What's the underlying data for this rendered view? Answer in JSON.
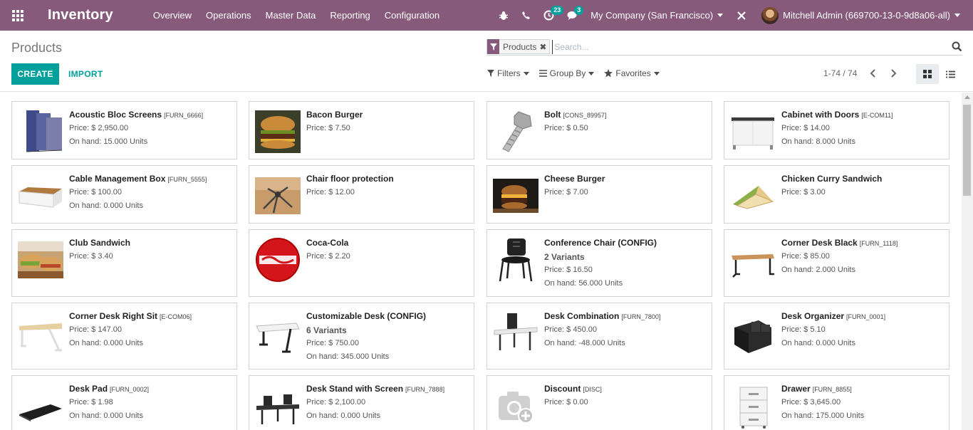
{
  "navbar": {
    "apps_icon": "apps-grid-icon",
    "brand": "Inventory",
    "menu": [
      "Overview",
      "Operations",
      "Master Data",
      "Reporting",
      "Configuration"
    ],
    "activity_badge": "23",
    "messages_badge": "3",
    "company": "My Company (San Francisco)",
    "user": "Mitchell Admin (669700-13-0-9d8a06-all)",
    "brand_color": "#875a7b"
  },
  "control": {
    "title": "Products",
    "create_label": "CREATE",
    "import_label": "IMPORT",
    "facet_label": "Products",
    "search_placeholder": "Search...",
    "filters_label": "Filters",
    "groupby_label": "Group By",
    "favorites_label": "Favorites",
    "pager": "1-74 / 74",
    "accent_color": "#00a09d"
  },
  "products": [
    {
      "name": "Acoustic Bloc Screens",
      "ref": "[FURN_6666]",
      "price": "Price: $ 2,950.00",
      "onhand": "On hand: 15.000 Units",
      "icon": "acoustic-screens-image"
    },
    {
      "name": "Bacon Burger",
      "ref": "",
      "price": "Price: $ 7.50",
      "onhand": "",
      "icon": "burger-image"
    },
    {
      "name": "Bolt",
      "ref": "[CONS_89957]",
      "price": "Price: $ 0.50",
      "onhand": "",
      "icon": "bolt-image"
    },
    {
      "name": "Cabinet with Doors",
      "ref": "[E-COM11]",
      "price": "Price: $ 14.00",
      "onhand": "On hand: 8.000 Units",
      "icon": "cabinet-image"
    },
    {
      "name": "Cable Management Box",
      "ref": "[FURN_5555]",
      "price": "Price: $ 100.00",
      "onhand": "On hand: 0.000 Units",
      "icon": "cable-box-image"
    },
    {
      "name": "Chair floor protection",
      "ref": "",
      "price": "Price: $ 12.00",
      "onhand": "",
      "icon": "chair-protection-image"
    },
    {
      "name": "Cheese Burger",
      "ref": "",
      "price": "Price: $ 7.00",
      "onhand": "",
      "icon": "cheese-burger-image"
    },
    {
      "name": "Chicken Curry Sandwich",
      "ref": "",
      "price": "Price: $ 3.00",
      "onhand": "",
      "icon": "sandwich-image"
    },
    {
      "name": "Club Sandwich",
      "ref": "",
      "price": "Price: $ 3.40",
      "onhand": "",
      "icon": "club-sandwich-image"
    },
    {
      "name": "Coca-Cola",
      "ref": "",
      "price": "Price: $ 2.20",
      "onhand": "",
      "icon": "coca-cola-image"
    },
    {
      "name": "Conference Chair (CONFIG)",
      "ref": "",
      "variants": "2 Variants",
      "price": "Price: $ 16.50",
      "onhand": "On hand: 56.000 Units",
      "icon": "conference-chair-image"
    },
    {
      "name": "Corner Desk Black",
      "ref": "[FURN_1118]",
      "price": "Price: $ 85.00",
      "onhand": "On hand: 2.000 Units",
      "icon": "corner-desk-image"
    },
    {
      "name": "Corner Desk Right Sit",
      "ref": "[E-COM06]",
      "price": "Price: $ 147.00",
      "onhand": "On hand: 0.000 Units",
      "icon": "corner-desk-right-image"
    },
    {
      "name": "Customizable Desk (CONFIG)",
      "ref": "",
      "variants": "6 Variants",
      "price": "Price: $ 750.00",
      "onhand": "On hand: 345.000 Units",
      "icon": "customizable-desk-image"
    },
    {
      "name": "Desk Combination",
      "ref": "[FURN_7800]",
      "price": "Price: $ 450.00",
      "onhand": "On hand: -48.000 Units",
      "icon": "desk-combination-image"
    },
    {
      "name": "Desk Organizer",
      "ref": "[FURN_0001]",
      "price": "Price: $ 5.10",
      "onhand": "On hand: 0.000 Units",
      "icon": "desk-organizer-image"
    },
    {
      "name": "Desk Pad",
      "ref": "[FURN_0002]",
      "price": "Price: $ 1.98",
      "onhand": "On hand: 0.000 Units",
      "icon": "desk-pad-image"
    },
    {
      "name": "Desk Stand with Screen",
      "ref": "[FURN_7888]",
      "price": "Price: $ 2,100.00",
      "onhand": "On hand: 0.000 Units",
      "icon": "desk-stand-image"
    },
    {
      "name": "Discount",
      "ref": "[DISC]",
      "price": "Price: $ 0.00",
      "onhand": "",
      "icon": "camera-placeholder-icon"
    },
    {
      "name": "Drawer",
      "ref": "[FURN_8855]",
      "price": "Price: $ 3,645.00",
      "onhand": "On hand: 175.000 Units",
      "icon": "drawer-image"
    }
  ]
}
